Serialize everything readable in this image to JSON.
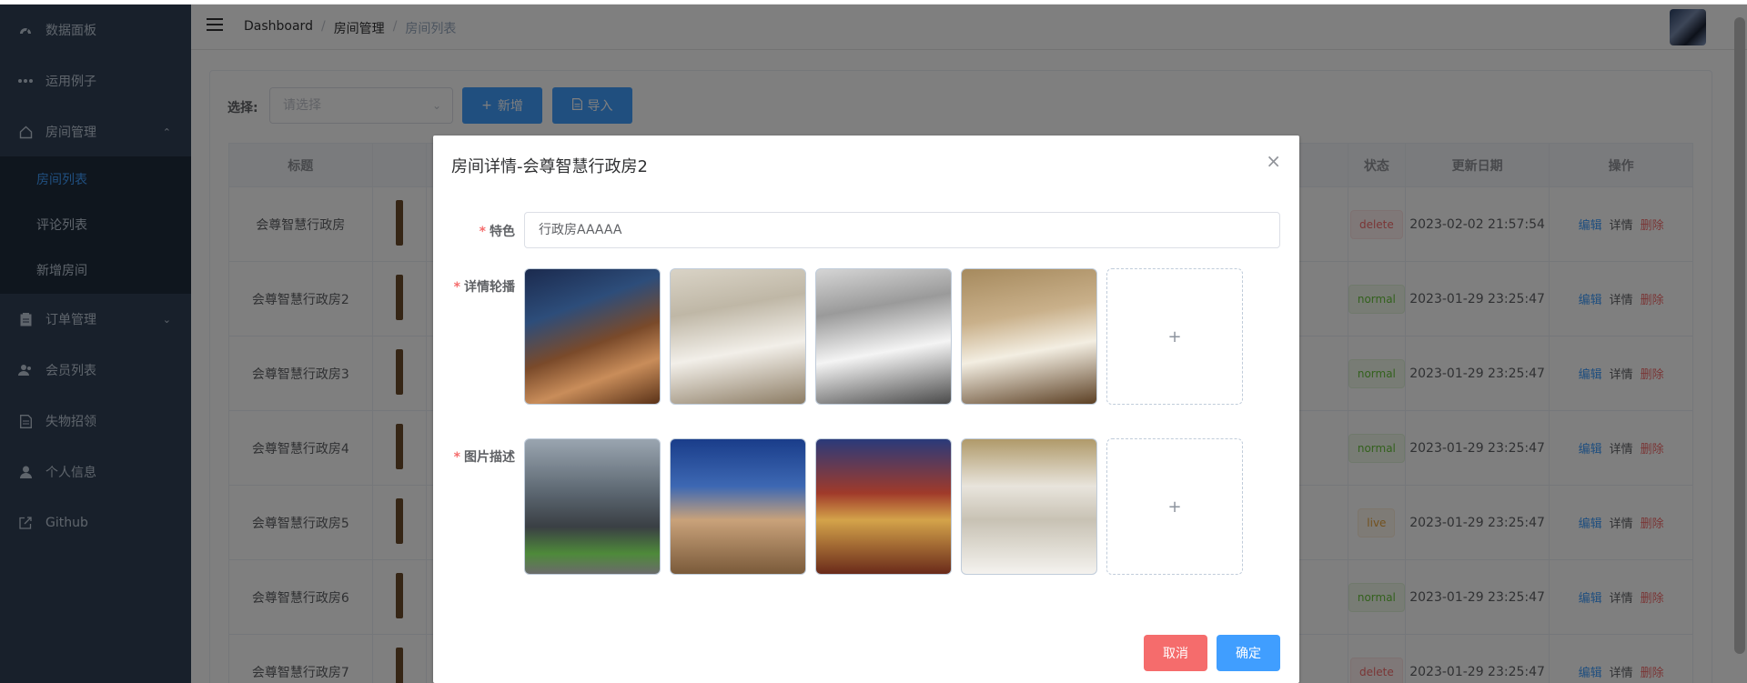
{
  "sidebar": {
    "items": [
      {
        "label": "数据面板",
        "icon": "dashboard-icon"
      },
      {
        "label": "运用例子",
        "icon": "more-icon"
      },
      {
        "label": "房间管理",
        "icon": "home-icon"
      },
      {
        "label": "订单管理",
        "icon": "clipboard-icon"
      },
      {
        "label": "会员列表",
        "icon": "users-icon"
      },
      {
        "label": "失物招领",
        "icon": "document-icon"
      },
      {
        "label": "个人信息",
        "icon": "user-icon"
      },
      {
        "label": "Github",
        "icon": "external-link-icon"
      }
    ],
    "sub_items": [
      {
        "label": "房间列表"
      },
      {
        "label": "评论列表"
      },
      {
        "label": "新增房间"
      }
    ]
  },
  "breadcrumb": {
    "items": [
      "Dashboard",
      "房间管理",
      "房间列表"
    ],
    "sep": "/"
  },
  "filter": {
    "label": "选择:",
    "placeholder": "请选择"
  },
  "toolbar": {
    "add_label": "新增",
    "import_label": "导入"
  },
  "table": {
    "headers": {
      "title": "标题",
      "status": "状态",
      "date": "更新日期",
      "ops": "操作"
    },
    "ops": {
      "edit": "编辑",
      "detail": "详情",
      "delete": "删除"
    },
    "rows": [
      {
        "title": "会尊智慧行政房",
        "status": "delete",
        "date": "2023-02-02 21:57:54"
      },
      {
        "title": "会尊智慧行政房2",
        "status": "normal",
        "date": "2023-01-29 23:25:47"
      },
      {
        "title": "会尊智慧行政房3",
        "status": "normal",
        "date": "2023-01-29 23:25:47"
      },
      {
        "title": "会尊智慧行政房4",
        "status": "normal",
        "date": "2023-01-29 23:25:47"
      },
      {
        "title": "会尊智慧行政房5",
        "status": "live",
        "date": "2023-01-29 23:25:47"
      },
      {
        "title": "会尊智慧行政房6",
        "status": "normal",
        "date": "2023-01-29 23:25:47"
      },
      {
        "title": "会尊智慧行政房7",
        "status": "delete",
        "date": "2023-01-29 23:25:47"
      }
    ]
  },
  "dialog": {
    "title": "房间详情-会尊智慧行政房2",
    "close": "×",
    "feature_label": "特色",
    "feature_value": "行政房AAAAA",
    "carousel_label": "详情轮播",
    "desc_label": "图片描述",
    "upload_plus": "+",
    "cancel_label": "取消",
    "confirm_label": "确定",
    "required_mark": "*"
  },
  "colors": {
    "sidebar": "#304156",
    "primary": "#409eff",
    "danger": "#f56c6c",
    "success": "#67c23a",
    "warning": "#e6a23c"
  }
}
